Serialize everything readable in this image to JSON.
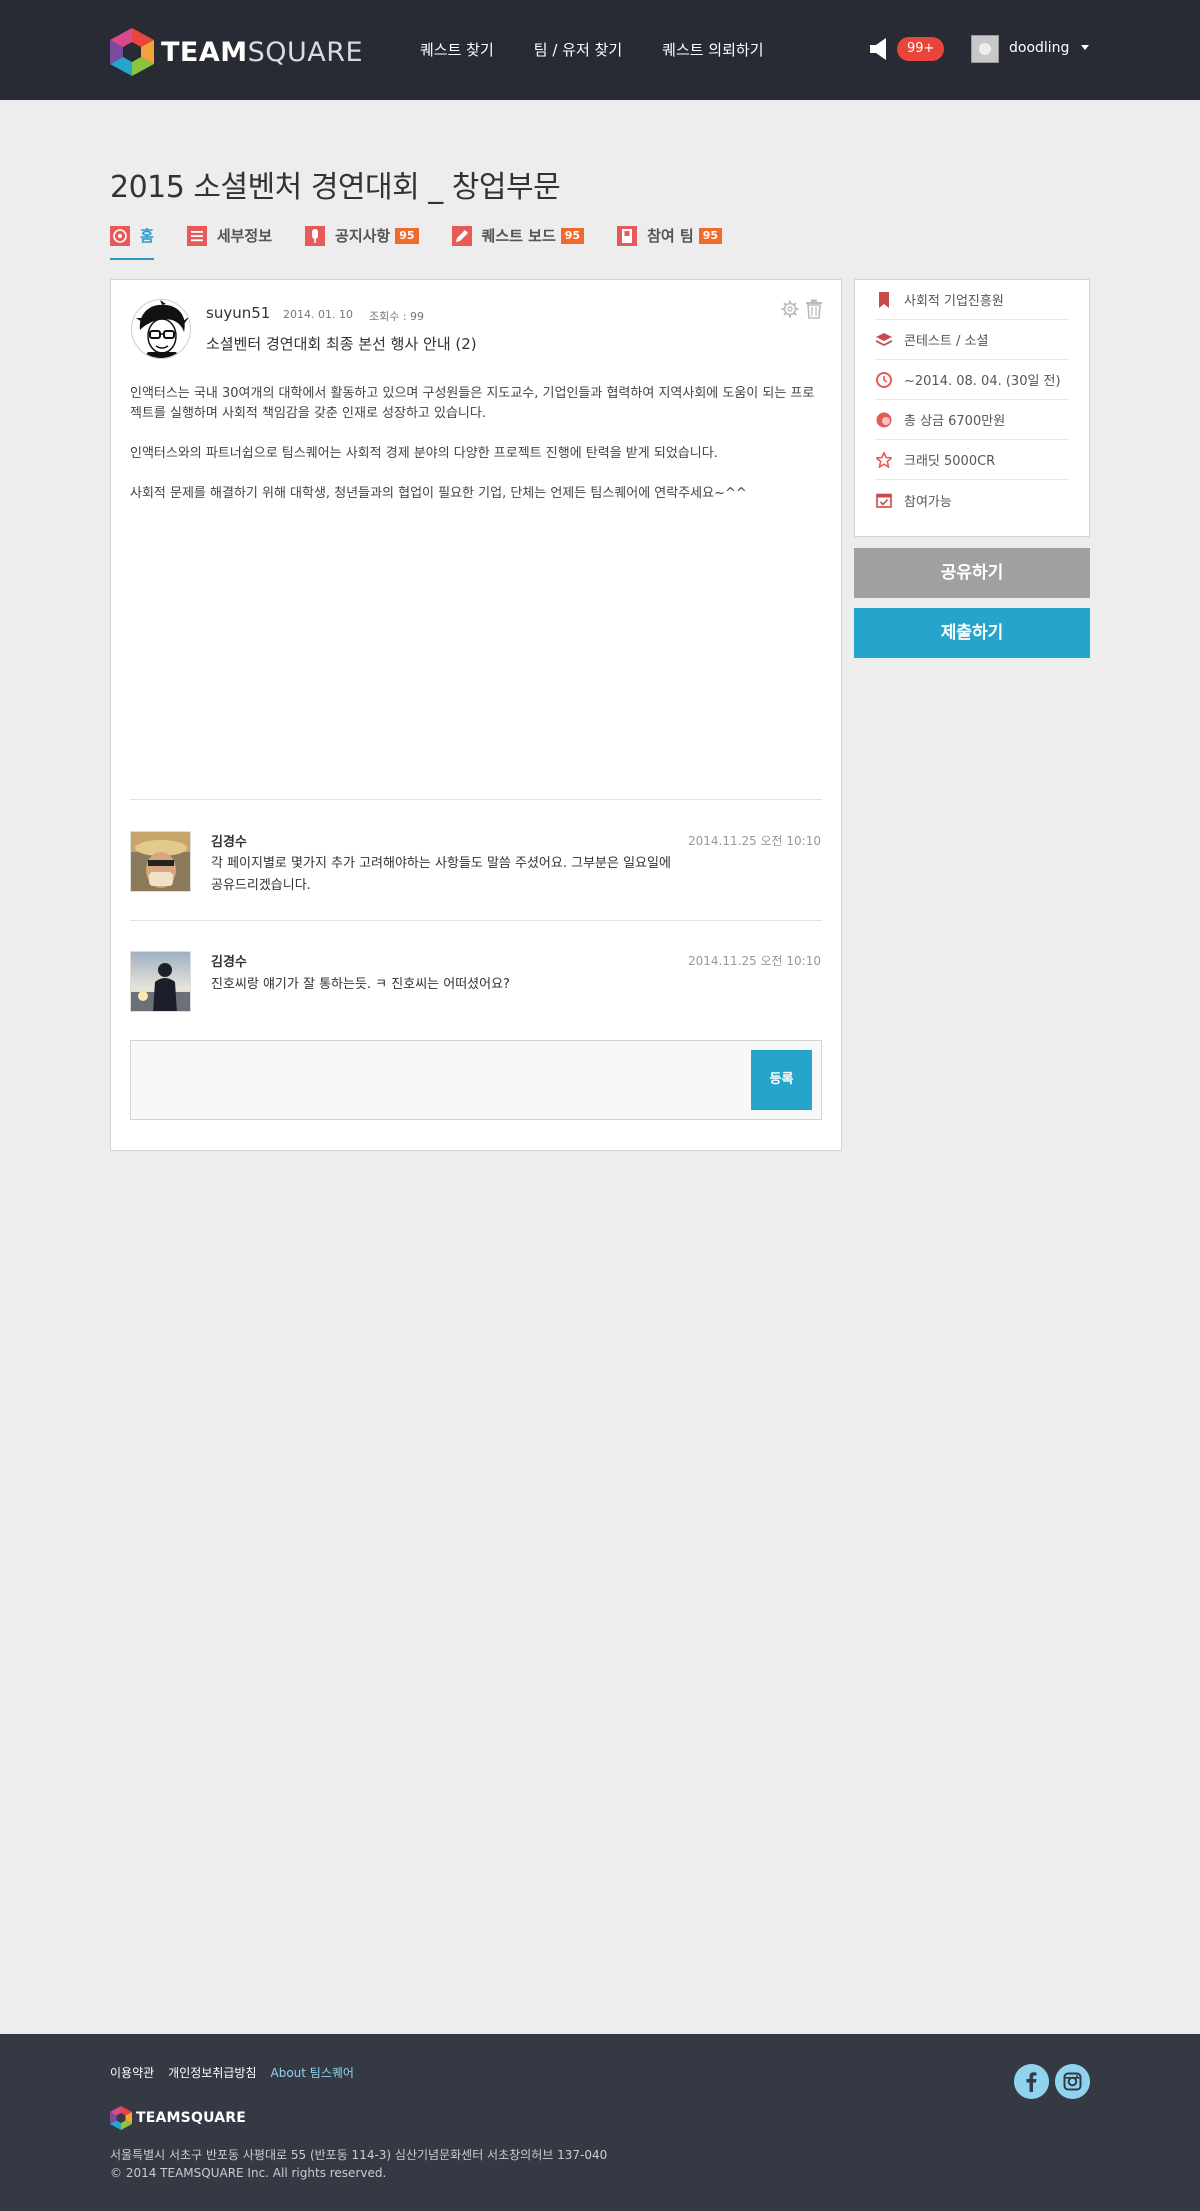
{
  "header": {
    "logo_bold": "TEAM",
    "logo_light": "SQUARE",
    "nav": [
      "퀘스트 찾기",
      "팀 / 유저 찾기",
      "퀘스트 의뢰하기"
    ],
    "notification_count": "99+",
    "username": "doodling"
  },
  "page": {
    "title": "2015 소셜벤처 경연대회 _ 창업부문"
  },
  "tabs": [
    {
      "label": "홈",
      "icon": "target-icon",
      "badge": "",
      "active": true
    },
    {
      "label": "세부정보",
      "icon": "list-icon",
      "badge": ""
    },
    {
      "label": "공지사항",
      "icon": "microphone-icon",
      "badge": "95"
    },
    {
      "label": "퀘스트 보드",
      "icon": "pencil-icon",
      "badge": "95"
    },
    {
      "label": "참여 팀",
      "icon": "team-icon",
      "badge": "95"
    }
  ],
  "post": {
    "author": "suyun51",
    "date": "2014. 01. 10",
    "views": "조회수 : 99",
    "title": "소셜벤터 경연대회  최종 본선 행사 안내 (2)",
    "body": [
      "인액터스는 국내 30여개의 대학에서 활동하고 있으며 구성원들은 지도교수, 기업인들과 협력하여 지역사회에 도움이 되는 프로젝트를 실행하며 사회적 책임감을 갖춘 인재로 성장하고 있습니다.",
      "인액터스와의 파트너쉽으로 팀스퀘어는 사회적 경제 분야의 다양한 프로젝트 진행에 탄력을 받게 되었습니다.",
      "사회적 문제를 해결하기 위해 대학생, 청년들과의 협업이 필요한 기업, 단체는 언제든 팀스퀘어에 연락주세요~^^"
    ]
  },
  "comments": [
    {
      "author": "김경수",
      "time": "2014.11.25 오전 10:10",
      "lines": [
        "각 페이지별로 몇가지 추가 고려해야하는 사항들도 말씀 주셨어요. 그부분은 일요일에",
        "공유드리겠습니다."
      ]
    },
    {
      "author": "김경수",
      "time": "2014.11.25 오전 10:10",
      "lines": [
        "진호씨랑 얘기가 잘 통하는듯. ㅋ 진호씨는 어떠셨어요?"
      ]
    }
  ],
  "reply": {
    "submit_label": "등록"
  },
  "sidebar": {
    "info": [
      {
        "icon": "bookmark-icon",
        "text": "사회적 기업진흥원"
      },
      {
        "icon": "layers-icon",
        "text": "콘테스트 / 소셜"
      },
      {
        "icon": "clock-icon",
        "text": "~2014. 08. 04. (30일 전)"
      },
      {
        "icon": "coin-icon",
        "text": "총 상금 6700만원"
      },
      {
        "icon": "star-icon",
        "text": "크래딧 5000CR"
      },
      {
        "icon": "calendar-check-icon",
        "text": "참여가능"
      }
    ],
    "share_label": "공유하기",
    "submit_label": "제출하기"
  },
  "footer": {
    "links": [
      "이용약관",
      "개인정보취급방침",
      "About 팀스퀘어"
    ],
    "logo_text": "TEAMSQUARE",
    "address": "서울특별시 서초구 반포동 사평대로 55 (반포동 114-3) 심산기념문화센터 서초창의허브 137-040",
    "copyright": "© 2014 TEAMSQUARE Inc. All rights reserved."
  },
  "colors": {
    "header_bg": "#282b33",
    "accent": "#26a5cc",
    "badge": "#f06a2c",
    "notification": "#e8463a",
    "icon_red": "#e85a5a",
    "footer_bg": "#343944"
  }
}
